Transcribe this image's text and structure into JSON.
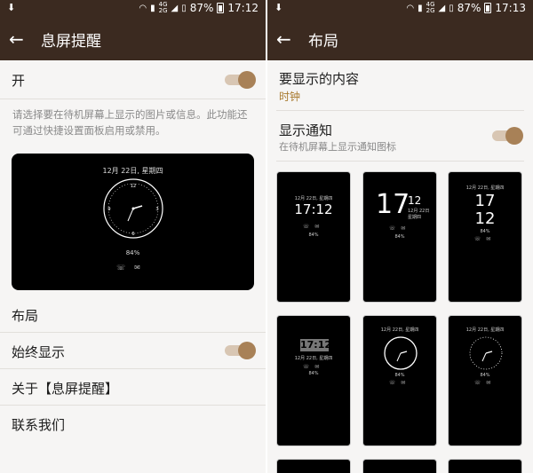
{
  "left": {
    "status": {
      "percent": "87%",
      "time": "17:12"
    },
    "title": "息屏提醒",
    "master_toggle": {
      "label": "开",
      "on": true
    },
    "description": "请选择要在待机屏幕上显示的图片或信息。此功能还可通过快捷设置面板启用或禁用。",
    "preview": {
      "date": "12月 22日, 星期四",
      "battery": "84%"
    },
    "items": [
      {
        "label": "布局"
      },
      {
        "label": "始终显示",
        "toggle": true
      },
      {
        "label": "关于【息屏提醒】"
      },
      {
        "label": "联系我们"
      }
    ]
  },
  "right": {
    "status": {
      "percent": "87%",
      "time": "17:13"
    },
    "title": "布局",
    "content_setting": {
      "label": "要显示的内容",
      "value": "时钟"
    },
    "notification_setting": {
      "label": "显示通知",
      "subtitle": "在待机屏幕上显示通知图标",
      "on": true
    },
    "thumbnails": [
      {
        "style": "digital-small",
        "date": "12月 22日, 星期四",
        "time": "17:12",
        "battery": "84%"
      },
      {
        "style": "digital-large-side",
        "hour": "17",
        "minute": "12",
        "date": "12月 22日\n星期四",
        "battery": "84%"
      },
      {
        "style": "digital-stacked",
        "date": "12月 22日, 星期四",
        "hour": "17",
        "minute": "12",
        "battery": "84%"
      },
      {
        "style": "digital-boxed",
        "time": "17:12",
        "date": "12月 22日, 星期四",
        "battery": "84%"
      },
      {
        "style": "analog-plain",
        "date": "12月 22日, 星期四",
        "battery": "84%"
      },
      {
        "style": "analog-ticks",
        "date": "12月 22日, 星期四",
        "battery": "84%"
      }
    ]
  }
}
